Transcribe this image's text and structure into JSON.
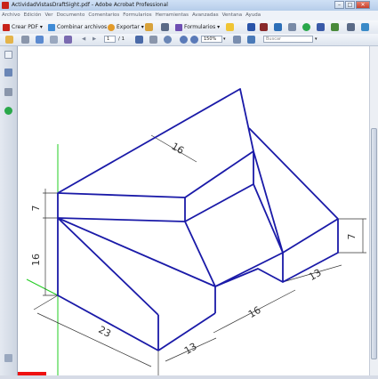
{
  "window": {
    "title": "ActividadVistasDraftSight.pdf - Adobe Acrobat Professional",
    "minimize": "–",
    "maximize": "□",
    "close": "✕"
  },
  "menu": [
    "Archivo",
    "Edición",
    "Ver",
    "Documento",
    "Comentarios",
    "Formularios",
    "Herramientas",
    "Avanzadas",
    "Ventana",
    "Ayuda"
  ],
  "toolbar": {
    "create_pdf": "Crear PDF",
    "combine": "Combinar archivos",
    "export": "Exportar",
    "forms": "Formularios"
  },
  "navigation": {
    "page": "1",
    "total": "/ 1",
    "zoom": "150%",
    "search_placeholder": "Buscar"
  },
  "drawing": {
    "dimensions": [
      "16",
      "7",
      "16",
      "7",
      "13",
      "16",
      "23",
      "13"
    ],
    "line_color": "#1a1aa8",
    "dim_color": "#333333",
    "axis_color": "#22cc22"
  }
}
